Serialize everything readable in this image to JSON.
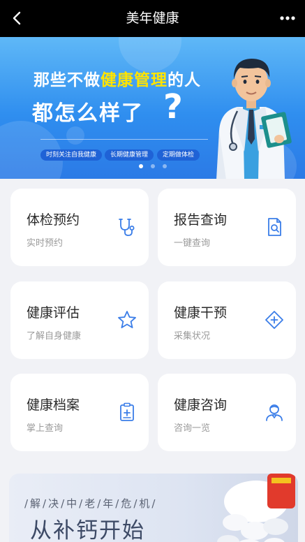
{
  "nav": {
    "title": "美年健康",
    "back_icon": "chevron-left-icon",
    "more_icon": "more-dots-icon"
  },
  "banner": {
    "line1_before": "那些不做",
    "line1_highlight": "健康管理",
    "line1_after": "的人",
    "line2": "都怎么样了",
    "question_mark": "?",
    "pills": [
      "时刻关注自我健康",
      "长期健康管理",
      "定期做体检"
    ],
    "slide_count": 3,
    "active_slide": 1,
    "highlight_color": "#ffe400"
  },
  "cards": [
    {
      "title": "体检预约",
      "subtitle": "实时预约",
      "icon": "stethoscope-icon"
    },
    {
      "title": "报告查询",
      "subtitle": "一键查询",
      "icon": "report-search-icon"
    },
    {
      "title": "健康评估",
      "subtitle": "了解自身健康",
      "icon": "star-icon"
    },
    {
      "title": "健康干预",
      "subtitle": "采集状况",
      "icon": "medical-plus-icon"
    },
    {
      "title": "健康档案",
      "subtitle": "掌上查询",
      "icon": "clipboard-plus-icon"
    },
    {
      "title": "健康咨询",
      "subtitle": "咨询一览",
      "icon": "doctor-icon"
    }
  ],
  "promo": {
    "subtitle": "/解/决/中/老/年/危/机/",
    "title": "从补钙开始"
  },
  "colors": {
    "accent": "#3a7de8",
    "navbar": "#000000"
  }
}
